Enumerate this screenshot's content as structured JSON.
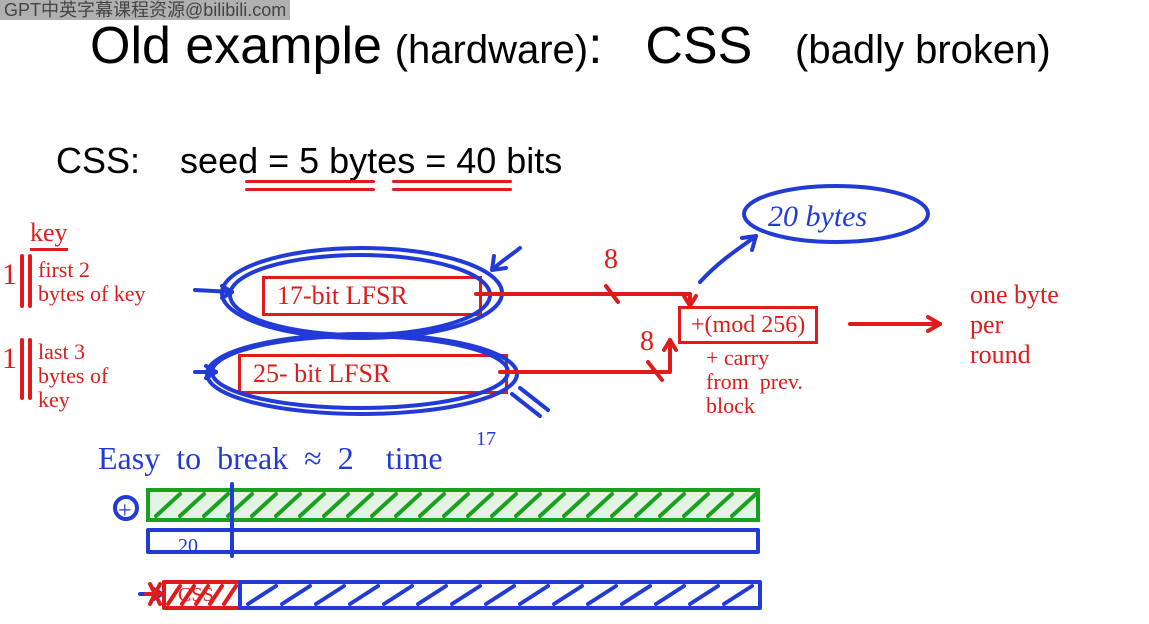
{
  "watermark": "GPT中英字幕课程资源@bilibili.com",
  "title": {
    "old_example": "Old example",
    "hardware": "(hardware)",
    "colon": ":",
    "css": "CSS",
    "badly": "(badly broken)"
  },
  "line2": {
    "css": "CSS:",
    "seed": "seed = 5 bytes = 40 bits"
  },
  "annotations": {
    "key_label": "key",
    "first2": "first 2\nbytes of key",
    "last3": "last 3\nbytes of\nkey",
    "one_prefix_top": "1",
    "one_prefix_bot": "1",
    "lfsr17": "17-bit  LFSR",
    "lfsr25": "25- bit  LFSR",
    "eight_top": "8",
    "eight_bot": "8",
    "modbox": "+(mod 256)",
    "carry": "+ carry\nfrom  prev.\nblock",
    "out": "one byte\nper\nround",
    "bytes20_oval": "20 bytes",
    "easy": "Easy  to  break  ≈  2    time",
    "exp17": "17",
    "twenty_bar": "20",
    "css_bar": "CSS",
    "plus_circle": "+"
  }
}
